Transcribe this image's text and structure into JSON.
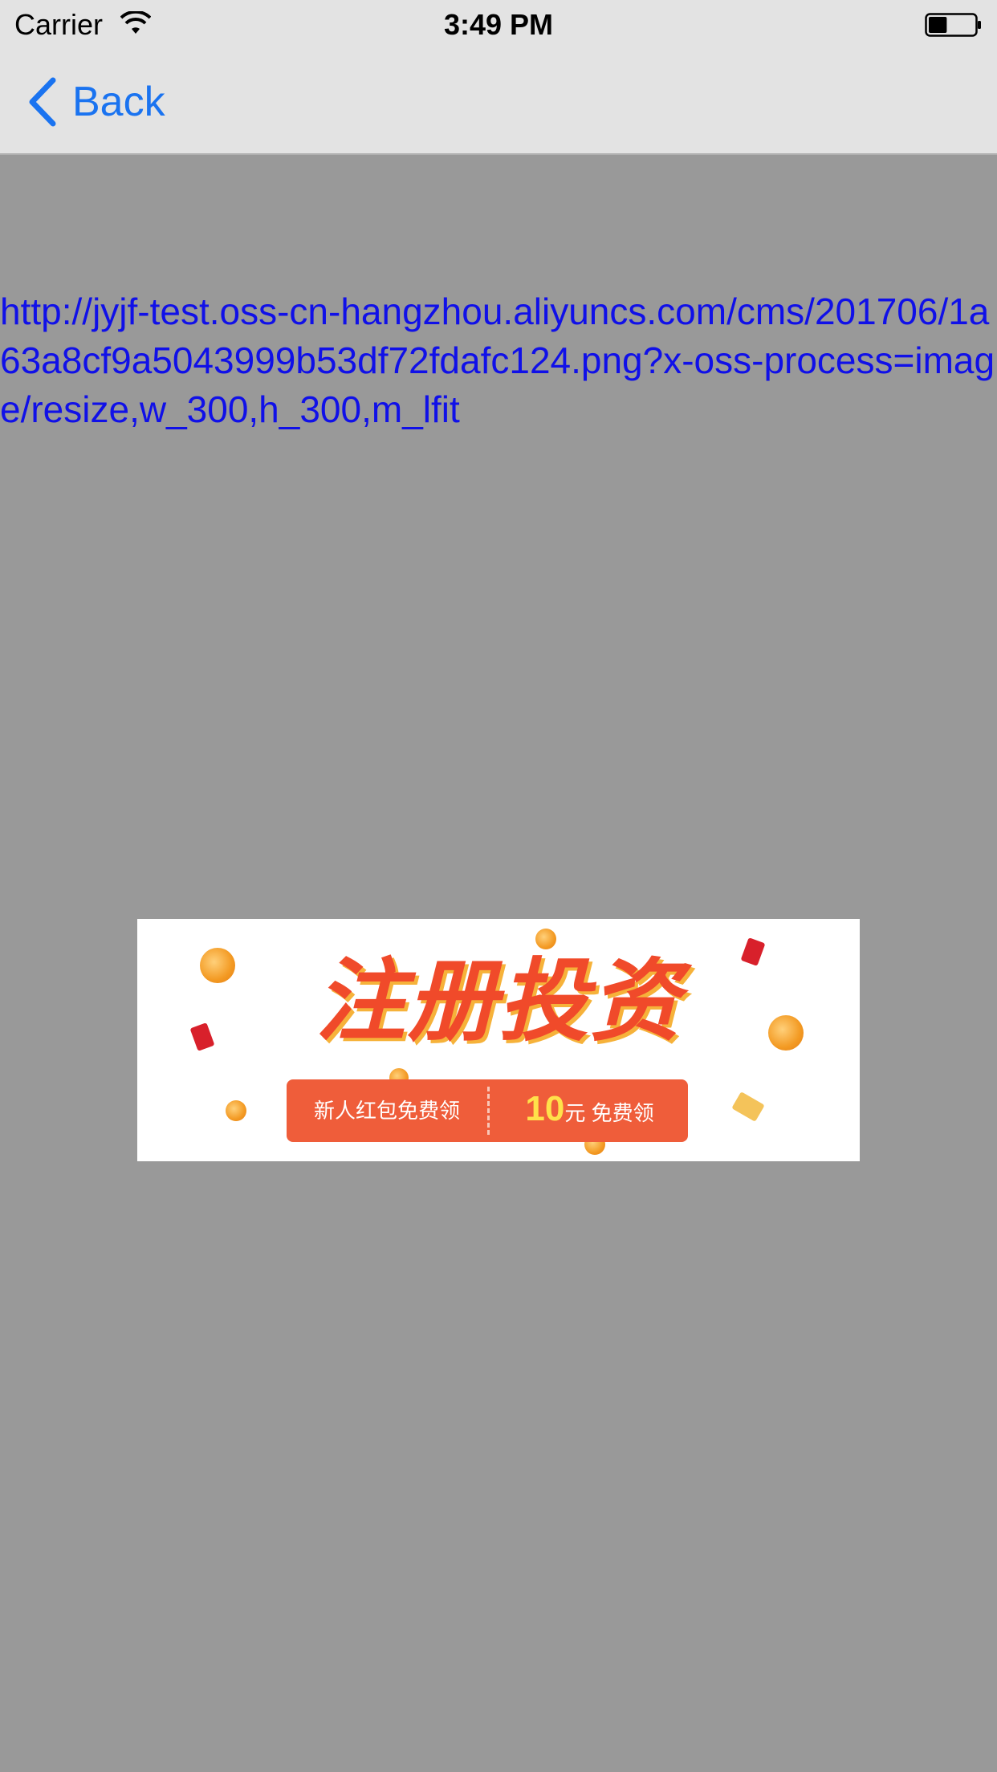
{
  "status_bar": {
    "carrier": "Carrier",
    "time": "3:49 PM",
    "battery_level": 0.4
  },
  "nav": {
    "back_label": "Back"
  },
  "content": {
    "url": "http://jyjf-test.oss-cn-hangzhou.aliyuncs.com/cms/201706/1a63a8cf9a5043999b53df72fdafc124.png?x-oss-process=image/resize,w_300,h_300,m_lfit"
  },
  "banner": {
    "title": "注册投资",
    "ribbon_left": "新人红包免费领",
    "ribbon_amount": "10",
    "ribbon_unit": "元",
    "ribbon_right": "免费领"
  },
  "colors": {
    "background": "#999999",
    "bar_background": "#e3e3e3",
    "link_blue": "#1010e8",
    "ios_blue": "#1a73f0",
    "banner_red": "#f04a2a"
  },
  "icons": {
    "wifi": "wifi-icon",
    "battery": "battery-icon",
    "back": "chevron-left-icon"
  }
}
